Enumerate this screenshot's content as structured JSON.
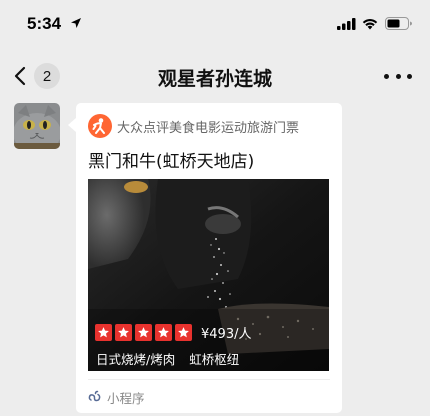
{
  "status_bar": {
    "time": "5:34",
    "icons": [
      "location-arrow-icon",
      "signal-icon",
      "wifi-icon",
      "battery-icon"
    ]
  },
  "nav": {
    "back_icon": "chevron-left-icon",
    "unread_count": "2",
    "title": "观星者孙连城",
    "more_icon": "ellipsis-icon"
  },
  "message": {
    "avatar": "cat-avatar",
    "card": {
      "source_logo": "dianping-logo",
      "source_name": "大众点评美食电影运动旅游门票",
      "title": "黑门和牛(虹桥天地店)",
      "rating_stars": 5,
      "price": "¥493/人",
      "cuisine": "日式烧烤/烤肉",
      "district": "虹桥枢纽",
      "footer_label": "小程序",
      "colors": {
        "star": "#e8322e",
        "brand": "#ff6633",
        "miniprogram": "#576b95"
      }
    }
  }
}
